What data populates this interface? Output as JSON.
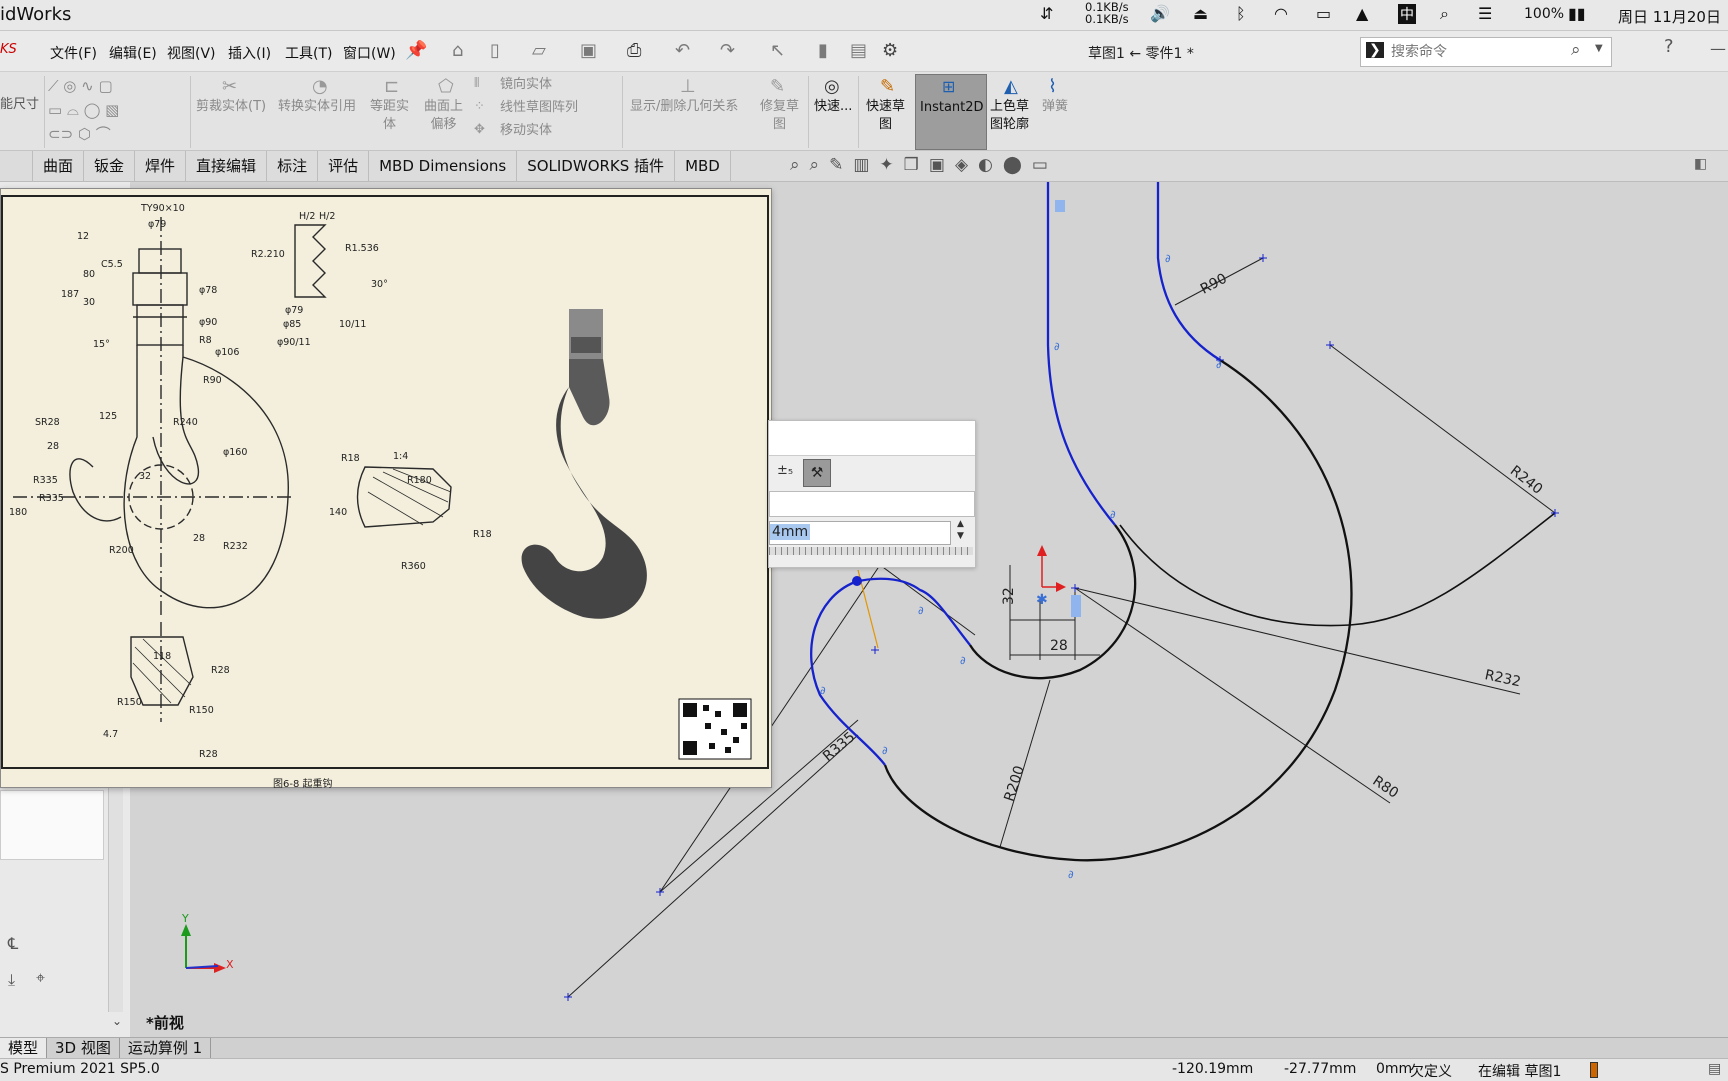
{
  "macbar": {
    "app_name": "idWorks",
    "net_up": "0.1KB/s",
    "net_down": "0.1KB/s",
    "battery": "100%",
    "ime": "中",
    "datetime": "周日 11月20日"
  },
  "menubar": {
    "items": [
      "文件(F)",
      "编辑(E)",
      "视图(V)",
      "插入(I)",
      "工具(T)",
      "窗口(W)"
    ],
    "doc_title": "草图1 ← 零件1 *",
    "search_placeholder": "搜索命令"
  },
  "ribbon": {
    "smart_dim": "能尺寸",
    "trim": "剪裁实体(T)",
    "convert": "转换实体引用",
    "offset": "等距实\n体",
    "surface_offset": "曲面上\n偏移",
    "mirror": "镜向实体",
    "linear_pattern": "线性草图阵列",
    "move": "移动实体",
    "relations": "显示/删除几何关系",
    "repair": "修复草\n图",
    "quick_snap": "快速...",
    "rapid_sketch": "快速草\n图",
    "instant2d": "Instant2D",
    "shaded": "上色草\n图轮廓",
    "spring": "弹簧"
  },
  "tabs": [
    "曲面",
    "钣金",
    "焊件",
    "直接编辑",
    "标注",
    "评估",
    "MBD Dimensions",
    "SOLIDWORKS 插件",
    "MBD"
  ],
  "dialog": {
    "value": "4mm"
  },
  "drawing": {
    "caption": "图6-8 起重钩",
    "labels": [
      "TY90×10",
      "φ79",
      "C5.5",
      "12",
      "80",
      "187",
      "30",
      "φ78",
      "φ90",
      "R8",
      "φ106",
      "15°",
      "R2.210",
      "H/2",
      "H/2",
      "R1.536",
      "30°",
      "φ79",
      "φ85",
      "φ90/11",
      "10/11",
      "R90",
      "R240",
      "SR28",
      "28",
      "125",
      "φ160",
      "R335",
      "R335",
      "32",
      "180",
      "R200",
      "28",
      "R232",
      "R18",
      "1:4",
      "R180",
      "140",
      "R18",
      "R360",
      "118",
      "R28",
      "R150",
      "R150",
      "4.7",
      "R28"
    ]
  },
  "sketch": {
    "dims": [
      "R90",
      "R240",
      "R232",
      "R80",
      "R200",
      "R335",
      "32",
      "28"
    ]
  },
  "view": {
    "name": "*前视"
  },
  "bottom_tabs": [
    "模型",
    "3D 视图",
    "运动算例 1"
  ],
  "status": {
    "product": "S Premium 2021 SP5.0",
    "x": "-120.19mm",
    "y": "-27.77mm",
    "z": "0mm",
    "state": "欠定义",
    "editing": "在编辑 草图1"
  }
}
